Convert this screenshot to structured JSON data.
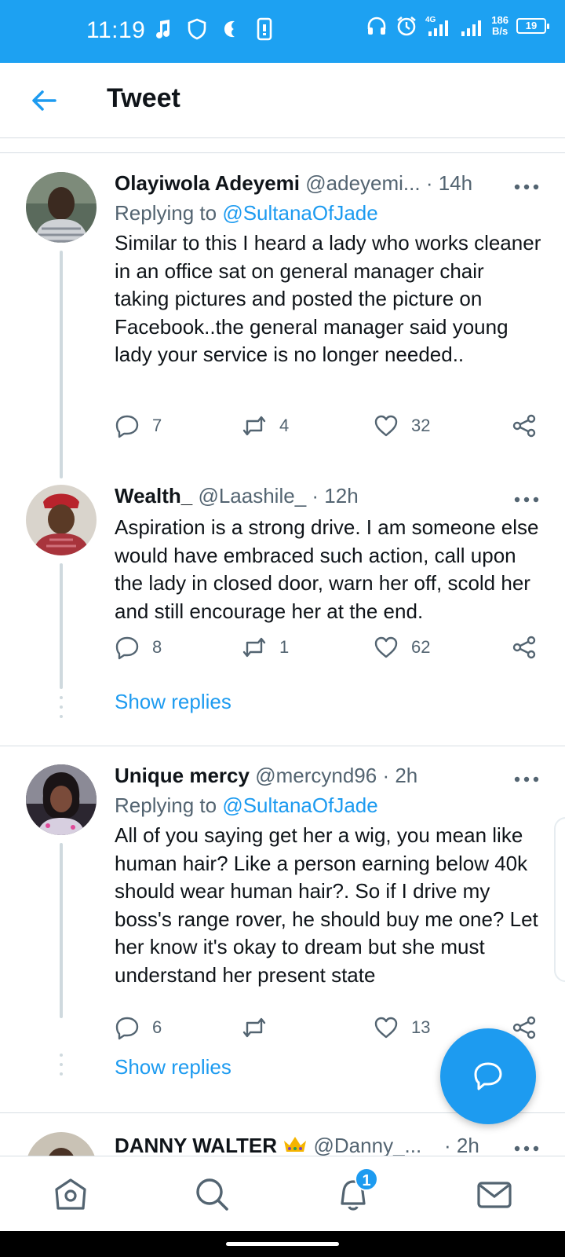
{
  "status_bar": {
    "time": "11:19",
    "net_speed_value": "186",
    "net_speed_unit": "B/s",
    "network": "4G",
    "battery": "19"
  },
  "header": {
    "title": "Tweet"
  },
  "tweets": [
    {
      "name": "Olayiwola Adeyemi",
      "handle": "@adeyemi...",
      "time": "· 14h",
      "replying_label": "Replying to",
      "replying_handle": "@SultanaOfJade",
      "text": "Similar to this I heard a lady who works cleaner in an office sat on general manager chair taking pictures and posted the picture on Facebook..the general manager said young lady your service is no longer needed..",
      "replies": "7",
      "retweets": "4",
      "likes": "32"
    },
    {
      "name": "Wealth_",
      "handle": "@Laashile_",
      "time": "· 12h",
      "text": "Aspiration is a strong drive. I am someone else would have embraced such action, call upon the lady in closed door, warn her off, scold her and still encourage her at the end.",
      "replies": "8",
      "retweets": "1",
      "likes": "62",
      "show_replies": "Show replies"
    },
    {
      "name": "Unique mercy",
      "handle": "@mercynd96",
      "time": "· 2h",
      "replying_label": "Replying to",
      "replying_handle": "@SultanaOfJade",
      "text": "All of you saying get her a wig, you mean like human hair? Like a person earning below 40k should wear human hair?. So if I drive my boss's range rover, he should buy me one? Let her know it's okay to dream but she must understand her present state",
      "replies": "6",
      "retweets": "",
      "likes": "13",
      "show_replies": "Show replies"
    },
    {
      "name": "DANNY WALTER",
      "handle": "@Danny_...",
      "time": "· 2h"
    }
  ],
  "bottom_nav": {
    "notification_count": "1",
    "items": [
      "home-icon",
      "search-icon",
      "notifications-icon",
      "messages-icon"
    ]
  },
  "colors": {
    "accent": "#1d9bf0",
    "status_bar": "#1da1f2",
    "text_primary": "#0f1419",
    "text_secondary": "#536471"
  }
}
